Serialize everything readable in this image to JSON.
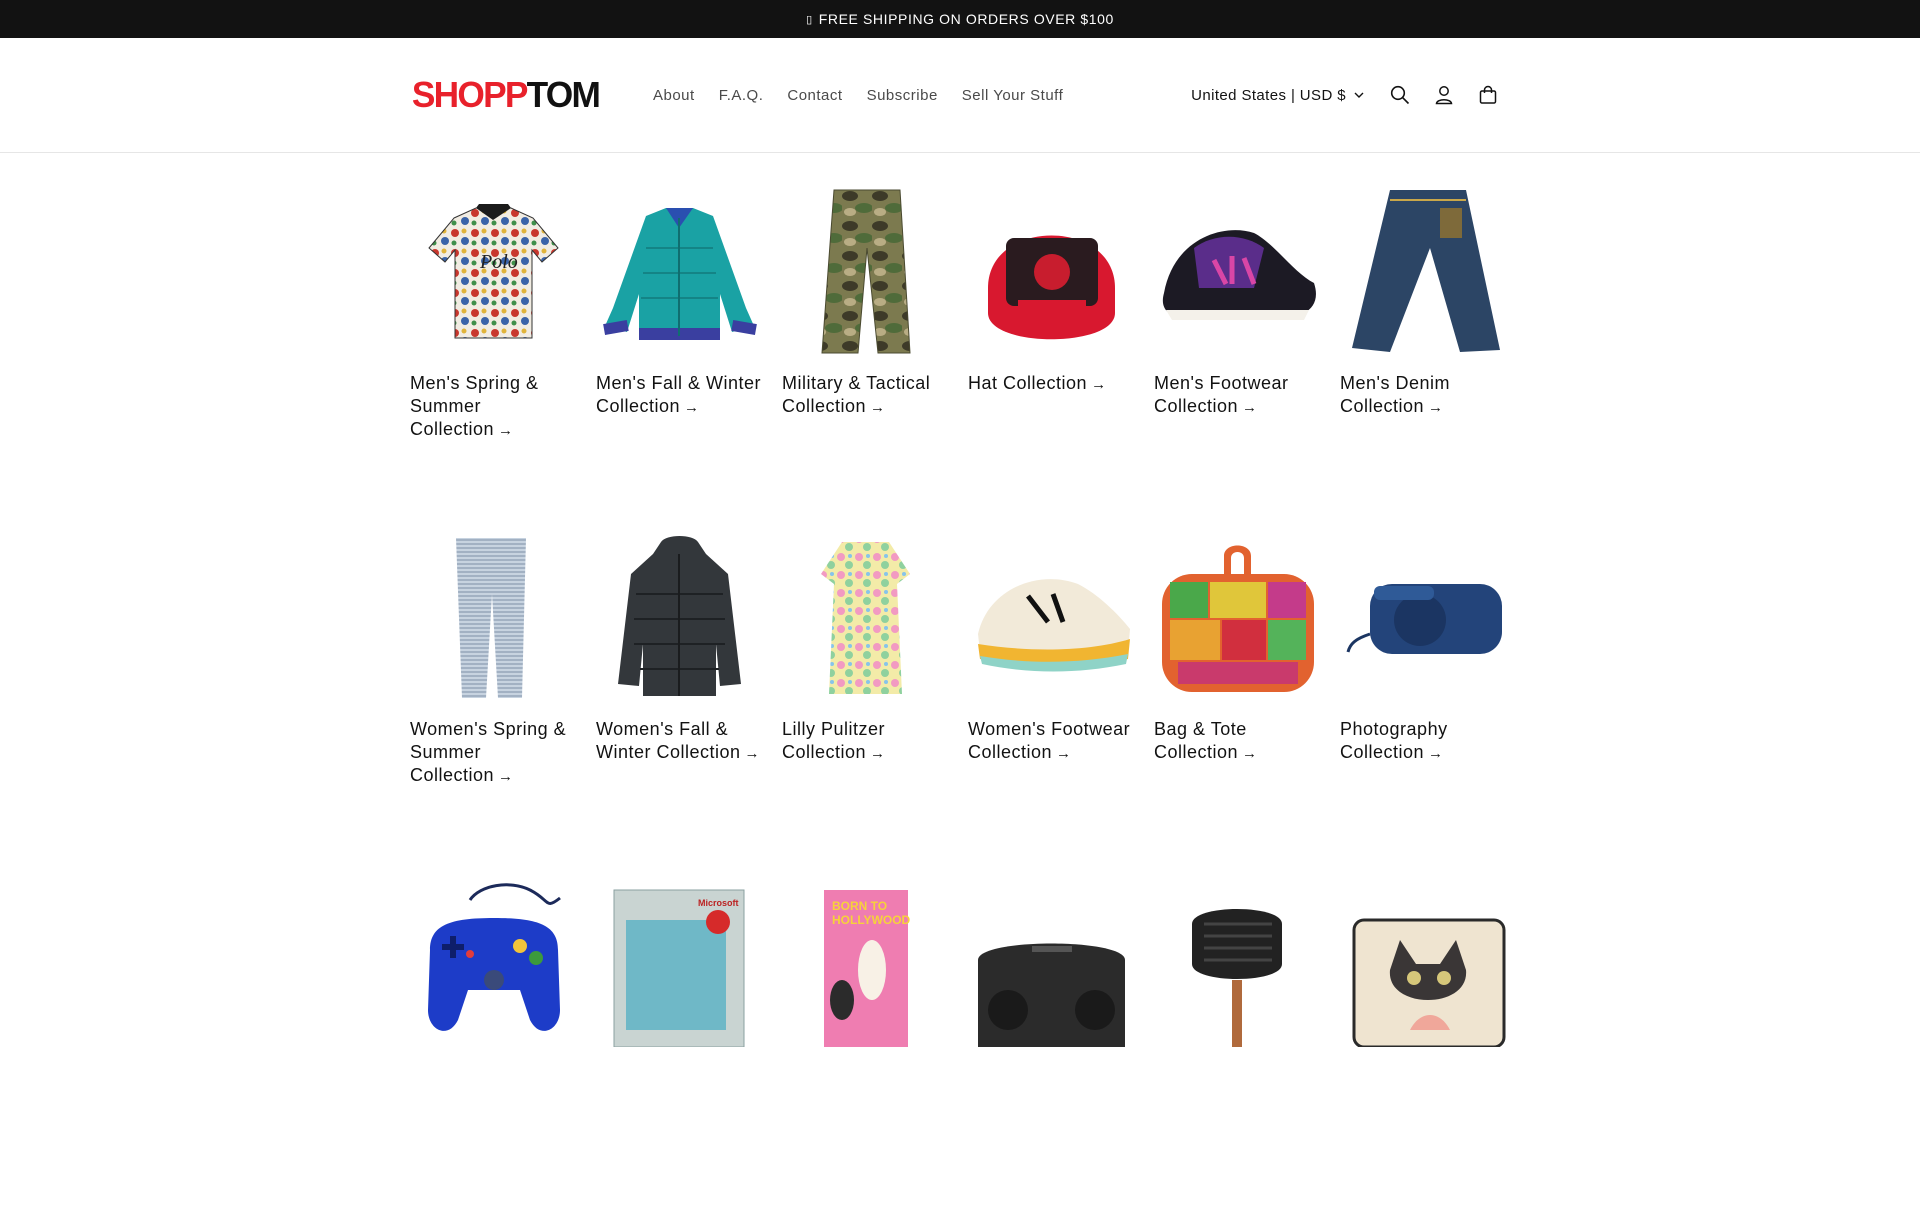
{
  "announcement": {
    "icon": "info-icon",
    "text": "FREE SHIPPING ON ORDERS OVER $100"
  },
  "header": {
    "logo": {
      "part1": "SHOPP",
      "part2": "TOM"
    },
    "nav": [
      {
        "label": "About"
      },
      {
        "label": "F.A.Q."
      },
      {
        "label": "Contact"
      },
      {
        "label": "Subscribe"
      },
      {
        "label": "Sell Your Stuff"
      }
    ],
    "country_selector": "United States | USD $",
    "icons": [
      "search-icon",
      "account-icon",
      "cart-icon"
    ]
  },
  "collections": [
    {
      "title": "Men's Spring & Summer Collection",
      "arrow": "→",
      "image": "floral-polo-shirt"
    },
    {
      "title": "Men's Fall & Winter Collection",
      "arrow": "→",
      "image": "teal-puffer-jacket"
    },
    {
      "title": "Military & Tactical Collection",
      "arrow": "→",
      "image": "camo-pants"
    },
    {
      "title": "Hat Collection",
      "arrow": "→",
      "image": "red-snapback-cap"
    },
    {
      "title": "Men's Footwear Collection",
      "arrow": "→",
      "image": "air-sneaker"
    },
    {
      "title": "Men's Denim Collection",
      "arrow": "→",
      "image": "denim-jeans"
    },
    {
      "title": "Women's Spring & Summer Collection",
      "arrow": "→",
      "image": "distressed-jeans"
    },
    {
      "title": "Women's Fall & Winter Collection",
      "arrow": "→",
      "image": "black-puffer-coat"
    },
    {
      "title": "Lilly Pulitzer Collection",
      "arrow": "→",
      "image": "pastel-dress"
    },
    {
      "title": "Women's Footwear Collection",
      "arrow": "→",
      "image": "running-shoe"
    },
    {
      "title": "Bag & Tote Collection",
      "arrow": "→",
      "image": "patchwork-bag"
    },
    {
      "title": "Photography Collection",
      "arrow": "→",
      "image": "blue-camera"
    },
    {
      "title": "",
      "arrow": "",
      "image": "blue-game-controller"
    },
    {
      "title": "",
      "arrow": "",
      "image": "software-box"
    },
    {
      "title": "",
      "arrow": "",
      "image": "vhs-tape"
    },
    {
      "title": "",
      "arrow": "",
      "image": "boombox"
    },
    {
      "title": "",
      "arrow": "",
      "image": "grill-pan"
    },
    {
      "title": "",
      "arrow": "",
      "image": "cat-pillow"
    }
  ],
  "colors": {
    "brand_red": "#e8212b",
    "bar": "#121212"
  }
}
